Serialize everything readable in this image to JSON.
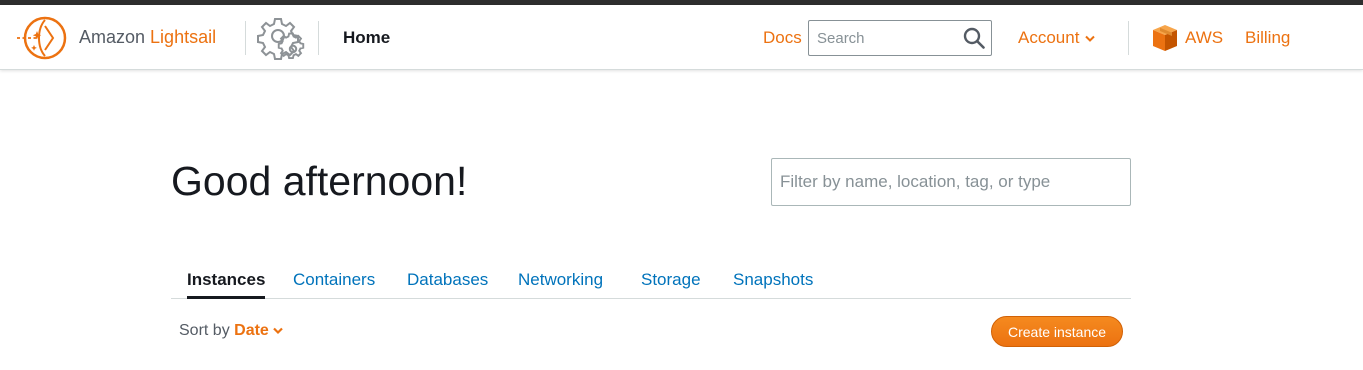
{
  "header": {
    "brand_prefix": "Amazon ",
    "brand_accent": "Lightsail",
    "home_label": "Home",
    "docs_label": "Docs",
    "search_placeholder": "Search",
    "account_label": "Account",
    "aws_label": "AWS",
    "billing_label": "Billing"
  },
  "main": {
    "greeting": "Good afternoon!",
    "filter_placeholder": "Filter by name, location, tag, or type",
    "tabs": [
      {
        "label": "Instances",
        "active": true
      },
      {
        "label": "Containers",
        "active": false
      },
      {
        "label": "Databases",
        "active": false
      },
      {
        "label": "Networking",
        "active": false
      },
      {
        "label": "Storage",
        "active": false
      },
      {
        "label": "Snapshots",
        "active": false
      }
    ],
    "sort_prefix": "Sort by ",
    "sort_value": "Date",
    "create_button_label": "Create instance"
  },
  "icons": {
    "logo": "lightsail-logo-icon",
    "settings": "gear-icon",
    "search": "search-icon",
    "account_dropdown": "chevron-down-icon",
    "aws": "aws-box-icon",
    "sort_dropdown": "chevron-down-icon"
  },
  "colors": {
    "accent": "#ec7211",
    "link": "#0073bb",
    "text": "#16191f",
    "muted": "#545b64",
    "topbar": "#2e2e2e"
  }
}
